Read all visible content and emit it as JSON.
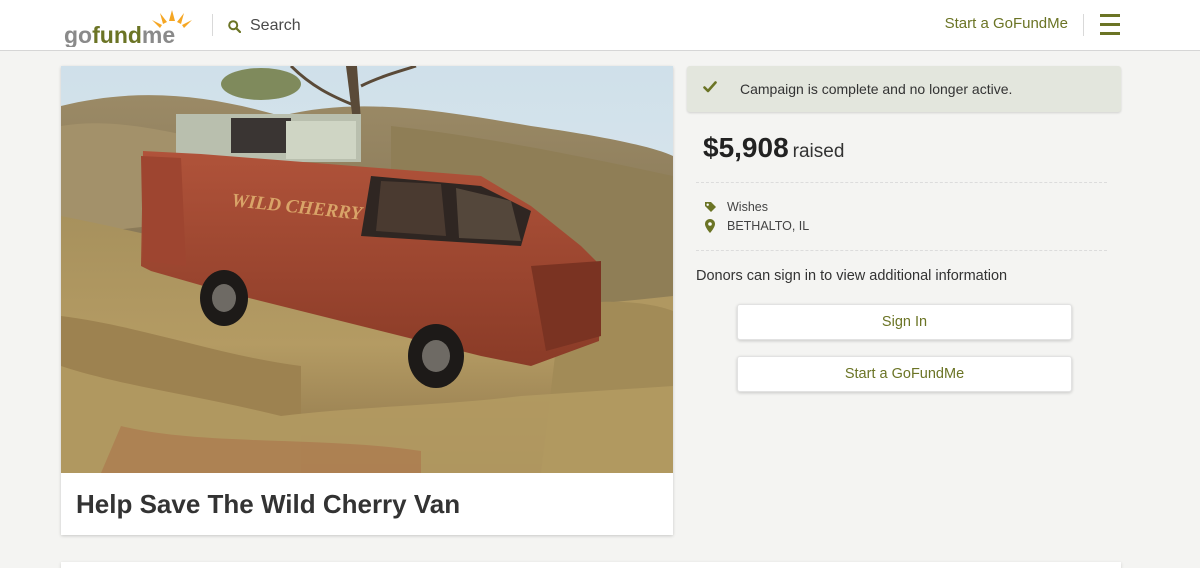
{
  "header": {
    "logo_text_go": "go",
    "logo_text_fund": "fund",
    "logo_text_me": "me",
    "search_label": "Search",
    "start_label": "Start a GoFundMe",
    "menu_icon": "hamburger-icon"
  },
  "campaign": {
    "title": "Help Save The Wild Cherry Van",
    "photo_caption_on_van": "WILD CHERRY"
  },
  "status": {
    "banner_text": "Campaign is complete and no longer active.",
    "icon": "check-icon"
  },
  "funding": {
    "amount": "$5,908",
    "raised_word": "raised"
  },
  "meta": {
    "category": "Wishes",
    "location": "BETHALTO, IL"
  },
  "donors": {
    "note": "Donors can sign in to view additional information",
    "sign_in_label": "Sign In",
    "start_label": "Start a GoFundMe"
  },
  "colors": {
    "accent": "#6b7425",
    "banner_bg": "#e3e6dd",
    "page_bg": "#f4f4f2"
  }
}
